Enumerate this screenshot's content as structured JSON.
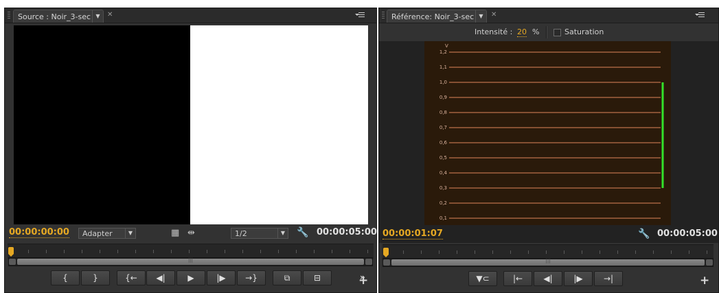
{
  "left_panel": {
    "tab_label": "Source : Noir_3-sec",
    "current_timecode": "00:00:00:00",
    "fit_dropdown": "Adapter",
    "resolution_dropdown": "1/2",
    "duration_timecode": "00:00:05:00",
    "transport_buttons": [
      {
        "name": "mark-in-button",
        "glyph": "{"
      },
      {
        "name": "mark-out-button",
        "glyph": "}"
      },
      {
        "name": "go-to-in-button",
        "glyph": "{←"
      },
      {
        "name": "step-back-button",
        "glyph": "◀|"
      },
      {
        "name": "play-button",
        "glyph": "▶"
      },
      {
        "name": "step-forward-button",
        "glyph": "|▶"
      },
      {
        "name": "go-to-out-button",
        "glyph": "→}"
      },
      {
        "name": "insert-button",
        "glyph": "⧉"
      },
      {
        "name": "overwrite-button",
        "glyph": "⊟"
      }
    ],
    "overflow_glyph": "»",
    "add_glyph": "+"
  },
  "right_panel": {
    "tab_label": "Référence: Noir_3-sec",
    "intensity_label": "Intensité :",
    "intensity_value": "20",
    "intensity_unit": "%",
    "saturation_label": "Saturation",
    "saturation_checked": false,
    "current_timecode": "00:00:01:07",
    "duration_timecode": "00:00:05:00",
    "transport_buttons": [
      {
        "name": "gang-to-source-button",
        "glyph": "▼⊂"
      },
      {
        "name": "go-to-in-button",
        "glyph": "|←"
      },
      {
        "name": "step-back-button",
        "glyph": "◀|"
      },
      {
        "name": "step-forward-button",
        "glyph": "|▶"
      },
      {
        "name": "go-to-out-button",
        "glyph": "→|"
      }
    ],
    "add_glyph": "+"
  },
  "scope": {
    "unit_label": "V",
    "levels": [
      "1,2",
      "1,1",
      "1,0",
      "0,9",
      "0,8",
      "0,7",
      "0,6",
      "0,5",
      "0,4",
      "0,3",
      "0,2",
      "0,1"
    ],
    "signal_range": [
      0.3,
      1.0
    ],
    "colors": {
      "background": "#2a1a0a",
      "gridline": "#e0875a",
      "signal": "#33e22a"
    }
  },
  "colors": {
    "accent": "#e5a823",
    "panel": "#323232"
  }
}
